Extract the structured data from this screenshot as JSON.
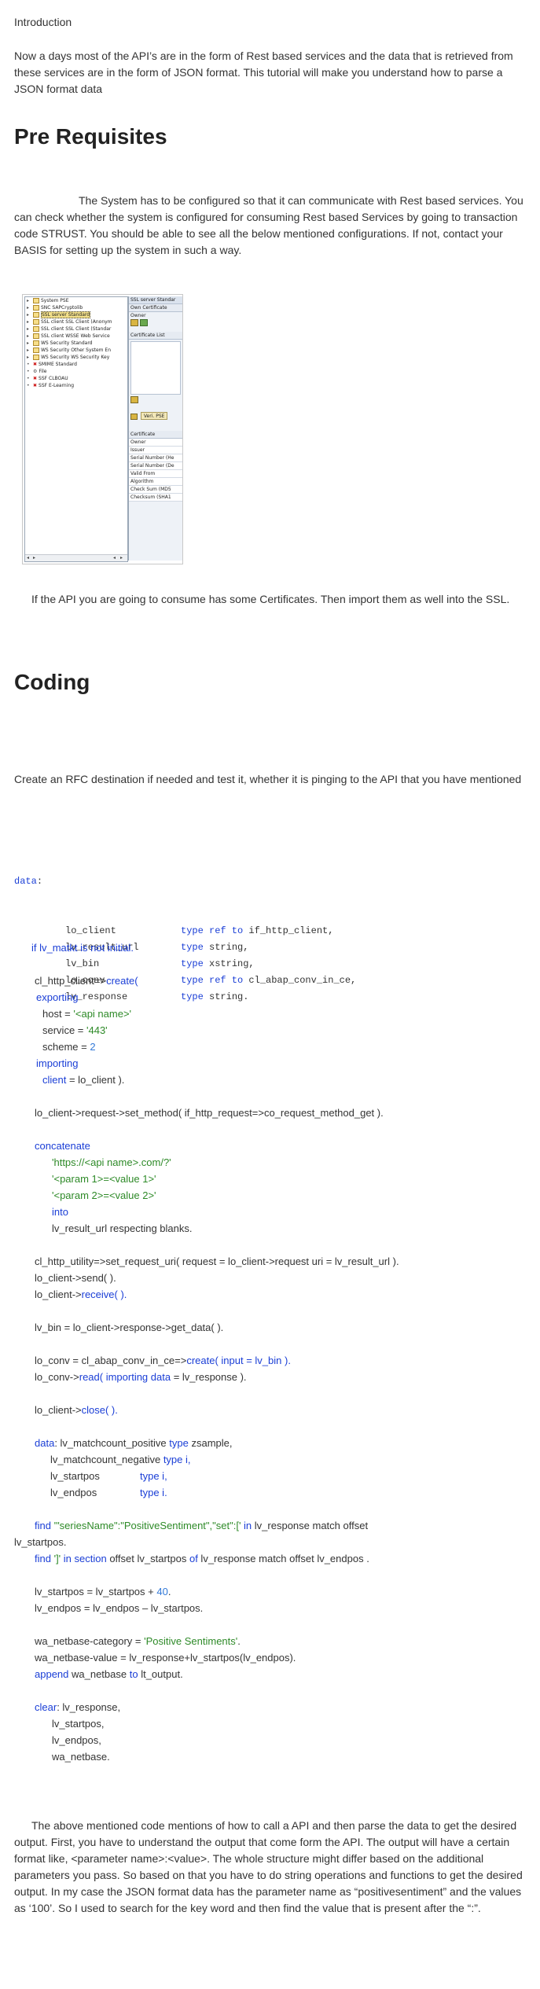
{
  "intro": {
    "label": "Introduction",
    "paragraph": "Now a days most of the API’s are in the form of Rest based services and the data that is retrieved from these services are in the form of JSON format. This tutorial will make you understand how to parse a JSON format data"
  },
  "prereq": {
    "heading": "Pre Requisites",
    "paragraph": "The System has to be configured so that it can communicate with Rest based services. You can check whether the system is configured for consuming Rest based Services by going to transaction code STRUST. You should be able to see all the below mentioned configurations. If not, contact your BASIS for setting up the system in such a way.",
    "after_image": "If the API you are going to consume has some Certificates. Then import them as well into the SSL."
  },
  "screenshot": {
    "tree": [
      {
        "label": "System PSE",
        "icon": "folder-icon"
      },
      {
        "label": "SNC SAPCryptolib",
        "icon": "folder-icon"
      },
      {
        "label": "SSL server Standard",
        "icon": "folder-icon"
      },
      {
        "label": "SSL client SSL Client (Anonym",
        "icon": "folder-icon"
      },
      {
        "label": "SSL client SSL Client (Standar",
        "icon": "folder-icon"
      },
      {
        "label": "SSL client WSSE Web Service",
        "icon": "folder-icon"
      },
      {
        "label": "WS Security Standard",
        "icon": "folder-icon"
      },
      {
        "label": "WS Security Other System En",
        "icon": "folder-icon"
      },
      {
        "label": "WS Security WS Security Key",
        "icon": "folder-icon"
      },
      {
        "label": "SMIME Standard",
        "icon": "error-x-icon"
      },
      {
        "label": "File",
        "icon": "gear-icon"
      },
      {
        "label": "SSF CLBOAU",
        "icon": "error-x-icon"
      },
      {
        "label": "SSF E-Learning",
        "icon": "error-x-icon"
      }
    ],
    "right": {
      "top_header": "SSL server Standar",
      "own_cert": "Own Certificate",
      "owner": "Owner",
      "cert_list": "Certificate List",
      "veri_pse": "Veri. PSE",
      "certificate": "Certificate",
      "fields": [
        "Owner",
        "Issuer",
        "Serial Number (He",
        "Serial Number (De",
        "Valid From",
        "Algorithm",
        "Check Sum (MD5",
        "Checksum (SHA1"
      ]
    }
  },
  "coding": {
    "heading": "Coding",
    "paragraph": "Create an RFC destination if needed and test it, whether it is pinging to the API that you have mentioned"
  },
  "code": {
    "data_kw": "data",
    "declarations": [
      {
        "name": "lo_client",
        "type_kw": "type ref to",
        "type": "if_http_client,"
      },
      {
        "name": "lv_result_url",
        "type_kw": "type",
        "type": "string,"
      },
      {
        "name": "lv_bin",
        "type_kw": "type",
        "type": "xstring,"
      },
      {
        "name": "lo_conv",
        "type_kw": "type ref to",
        "type": "cl_abap_conv_in_ce,"
      },
      {
        "name": "lv_response",
        "type_kw": "type",
        "type": "string."
      }
    ]
  },
  "abap": {
    "if_line": "if lv_matkt is not initial.",
    "l1": "cl_http_client=>",
    "l1_kw": "create(",
    "exporting": "exporting",
    "host_a": "host    = ",
    "host_v": "'<api name>'",
    "service_a": "service = ",
    "service_v": "'443'",
    "scheme_a": "scheme  = ",
    "scheme_v": "2",
    "importing": "importing",
    "client_a": "client",
    "client_b": "  = lo_client ).",
    "set_method": "lo_client->request->set_method( if_http_request=>co_request_method_get ).",
    "concatenate": "concatenate",
    "c1": "'https://&lt;api name>.com/?'",
    "c2": "'&lt;param 1>=&lt;value 1>'",
    "c3": "'&lt;param 2>=&lt;value 2>'",
    "into": "into",
    "c4": "lv_result_url respecting blanks.",
    "uri": "cl_http_utility=>set_request_uri( request = lo_client->request uri = lv_result_url ).",
    "send": "lo_client->send( ).",
    "recv_a": "lo_client->",
    "recv_b": "receive( ).",
    "getdata": "lv_bin = lo_client->response->get_data( ).",
    "conv_a": "lo_conv = cl_abap_conv_in_ce=>",
    "conv_b": "create( input = lv_bin ).",
    "read_a": "lo_conv->",
    "read_b": "read( importing data",
    "read_c": " = lv_response ).",
    "close_a": "lo_client->",
    "close_b": "close( ).",
    "d_kw": "data",
    "d_a": ": lv_matchcount_positive ",
    "d_type": "type",
    "d_b": " zsample,",
    "d2_a": "lv_matchcount_negative ",
    "d2_t": "type i,",
    "d3_a": "lv_startpos",
    "d3_t": "type i,",
    "d4_a": "lv_endpos",
    "d4_t": "type i.",
    "find1_kw": "find",
    "find1_s": " '\"seriesName\":\"PositiveSentiment\",\"set\":[' ",
    "find1_in": "in",
    "find1_rest": " lv_response match offset",
    "find1_cont": "lv_startpos.",
    "find2_kw": "find",
    "find2_s": " ']' ",
    "find2_in": "in section",
    "find2_a": " offset lv_startpos ",
    "find2_of": "of",
    "find2_b": " lv_response match offset lv_endpos .",
    "sp_a": "lv_startpos = lv_startpos + ",
    "sp_n": "40",
    "sp_b": ".",
    "ep": "lv_endpos = lv_endpos – lv_startpos.",
    "cat_a": "wa_netbase-category = ",
    "cat_s": "'Positive Sentiments'",
    "cat_b": ".",
    "val": "wa_netbase-value    = lv_response+lv_startpos(lv_endpos).",
    "app_kw": "append",
    "app_a": " wa_netbase ",
    "app_to": "to",
    "app_b": " lt_output.",
    "clr_kw": "clear",
    "clr_a": ": lv_response,",
    "clr2": "lv_startpos,",
    "clr3": "lv_endpos,",
    "clr4": "wa_netbase."
  },
  "closing": "The above mentioned code mentions of how to call a API and then parse the data to get the desired output. First, you have to understand the output that come form the API. The output will have a certain format like, &lt;parameter name>:&lt;value>. The whole structure might differ based on the additional parameters you pass. So based on that you have to do string operations and functions to get the desired output. In my case the JSON format data has the parameter name as “positivesentiment” and the values as ‘100’. So I used to search for the key word and then find the value that is present after the “:”."
}
